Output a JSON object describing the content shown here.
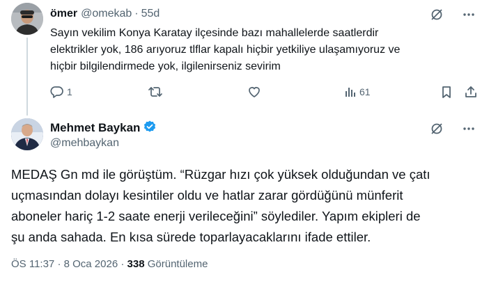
{
  "reply": {
    "author_name": "ömer",
    "author_handle": "@omekab",
    "separator": "·",
    "time": "55d",
    "text_lines": [
      "Sayın vekilim Konya Karatay ilçesinde bazı mahallelerde saatlerdir",
      "elektrikler yok, 186 arıyoruz tlflar kapalı hiçbir yetkiliye ulaşamıyoruz ve",
      "hiçbir bilgilendirmede yok, ilgilenirseniz sevirim"
    ],
    "actions": {
      "replies": "1",
      "retweets": "",
      "likes": "",
      "views": "61"
    }
  },
  "main": {
    "author_name": "Mehmet Baykan",
    "author_handle": "@mehbaykan",
    "verified": true,
    "text_lines": [
      "MEDAŞ Gn md ile görüştüm. “Rüzgar hızı çok yüksek olduğundan ve çatı",
      "uçmasından dolayı kesintiler oldu ve hatlar zarar gördüğünü münferit",
      "aboneler hariç 1-2 saate enerji verileceğini” söylediler. Yapım ekipleri de",
      "şu anda sahada. En kısa sürede toparlayacaklarını ifade ettiler."
    ],
    "meta": {
      "time": "ÖS 11:37",
      "separator": "·",
      "date": "8 Oca 2026",
      "views_count": "338",
      "views_label": "Görüntüleme"
    }
  },
  "colors": {
    "text": "#0f1419",
    "secondary": "#536471",
    "verified": "#1d9bf0",
    "thread_line": "#cfd9de"
  },
  "icons": [
    "grok-icon",
    "more-icon",
    "reply-icon",
    "retweet-icon",
    "like-icon",
    "views-icon",
    "bookmark-icon",
    "share-icon",
    "verified-badge-icon"
  ]
}
